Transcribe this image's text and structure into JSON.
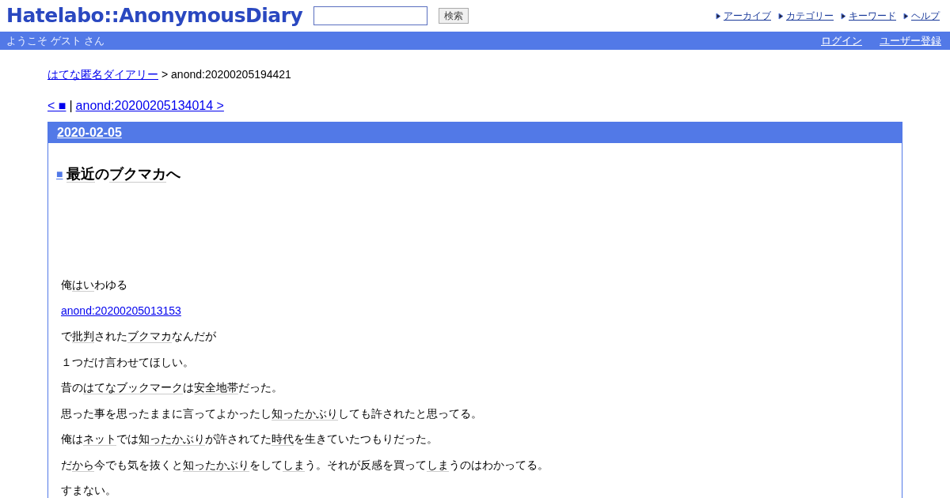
{
  "header": {
    "logo": "Hatelabo::AnonymousDiary",
    "search_button": "検索",
    "nav": [
      "アーカイブ",
      "カテゴリー",
      "キーワード",
      "ヘルプ"
    ]
  },
  "bar": {
    "welcome": "ようこそ ゲスト さん",
    "links": [
      "ログイン",
      "ユーザー登録"
    ]
  },
  "breadcrumb": {
    "link": "はてな匿名ダイアリー",
    "current": "> anond:20200205194421"
  },
  "pager": {
    "prev": "< ■",
    "separator": "|",
    "next": "anond:20200205134014 >"
  },
  "day": {
    "date": "2020-02-05",
    "title": {
      "mark": "■",
      "segments": [
        {
          "text": "最近",
          "keyword": true
        },
        {
          "text": "の",
          "keyword": false
        },
        {
          "text": "ブクマカ",
          "keyword": true
        },
        {
          "text": "へ",
          "keyword": false
        }
      ]
    },
    "body": [
      {
        "kind": "text",
        "segments": [
          {
            "text": "俺",
            "keyword": false
          },
          {
            "text": "はい",
            "keyword": true
          },
          {
            "text": "わゆる",
            "keyword": false
          }
        ]
      },
      {
        "kind": "link",
        "text": "anond:20200205013153"
      },
      {
        "kind": "text",
        "segments": [
          {
            "text": "で",
            "keyword": false
          },
          {
            "text": "批判",
            "keyword": true
          },
          {
            "text": "された",
            "keyword": false
          },
          {
            "text": "ブクマカ",
            "keyword": true
          },
          {
            "text": "なんだが",
            "keyword": false
          }
        ]
      },
      {
        "kind": "text",
        "segments": [
          {
            "text": "１つだけ言わせてほしい。",
            "keyword": false
          }
        ]
      },
      {
        "kind": "text",
        "segments": [
          {
            "text": "昔の",
            "keyword": false
          },
          {
            "text": "はてなブックマーク",
            "keyword": true
          },
          {
            "text": "は",
            "keyword": false
          },
          {
            "text": "安全地帯",
            "keyword": true
          },
          {
            "text": "だった。",
            "keyword": false
          }
        ]
      },
      {
        "kind": "text",
        "segments": [
          {
            "text": "思った事を思ったままに言ってよかったし",
            "keyword": false
          },
          {
            "text": "知ったかぶり",
            "keyword": true
          },
          {
            "text": "しても許されたと思ってる。",
            "keyword": false
          }
        ]
      },
      {
        "kind": "text",
        "segments": [
          {
            "text": "俺は",
            "keyword": false
          },
          {
            "text": "ネット",
            "keyword": true
          },
          {
            "text": "では",
            "keyword": false
          },
          {
            "text": "知ったかぶり",
            "keyword": true
          },
          {
            "text": "が許されてた",
            "keyword": false
          },
          {
            "text": "時代",
            "keyword": true
          },
          {
            "text": "を生きていたつもりだった。",
            "keyword": false
          }
        ]
      },
      {
        "kind": "text",
        "segments": [
          {
            "text": "だ",
            "keyword": false
          },
          {
            "text": "から",
            "keyword": true
          },
          {
            "text": "今でも気を抜くと",
            "keyword": false
          },
          {
            "text": "知ったかぶり",
            "keyword": true
          },
          {
            "text": "をして",
            "keyword": false
          },
          {
            "text": "しま",
            "keyword": true
          },
          {
            "text": "う。それが反感を買って",
            "keyword": false
          },
          {
            "text": "しま",
            "keyword": true
          },
          {
            "text": "うのはわかってる。",
            "keyword": false
          }
        ]
      },
      {
        "kind": "text",
        "segments": [
          {
            "text": "すまない。",
            "keyword": false
          }
        ]
      }
    ]
  }
}
